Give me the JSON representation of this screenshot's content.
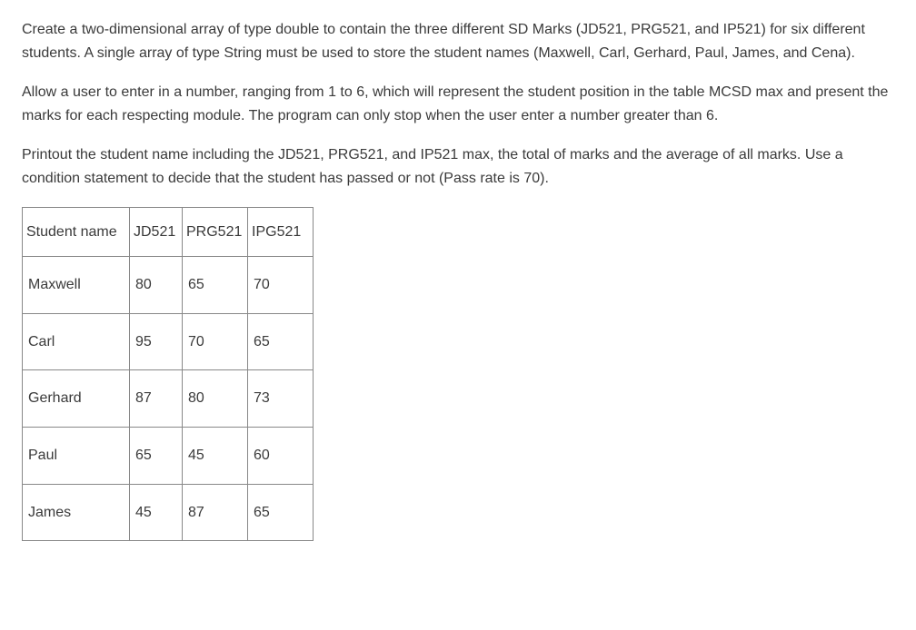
{
  "paragraphs": {
    "p1": "Create a two-dimensional array of type double to contain the three different SD Marks (JD521, PRG521, and IP521) for six different students. A single array of type String must be used to store the student names (Maxwell, Carl, Gerhard, Paul, James, and Cena).",
    "p2": "Allow a user to enter in a number, ranging from 1 to 6, which will represent the student position in the table MCSD max and present the marks for each respecting module. The program can only stop when the user enter a number greater than 6.",
    "p3": "Printout the student name including the JD521, PRG521, and IP521 max, the total of marks and the average of all marks. Use a condition statement to decide that the student has passed or not (Pass rate is 70)."
  },
  "table": {
    "headers": {
      "c0": "Student name",
      "c1": "JD521",
      "c2": "PRG521",
      "c3": "IPG521"
    },
    "rows": [
      {
        "name": "Maxwell",
        "jd": "80",
        "prg": "65",
        "ipg": "70"
      },
      {
        "name": "Carl",
        "jd": "95",
        "prg": "70",
        "ipg": "65"
      },
      {
        "name": "Gerhard",
        "jd": "87",
        "prg": "80",
        "ipg": "73"
      },
      {
        "name": "Paul",
        "jd": "65",
        "prg": "45",
        "ipg": "60"
      },
      {
        "name": "James",
        "jd": "45",
        "prg": "87",
        "ipg": "65"
      }
    ]
  }
}
